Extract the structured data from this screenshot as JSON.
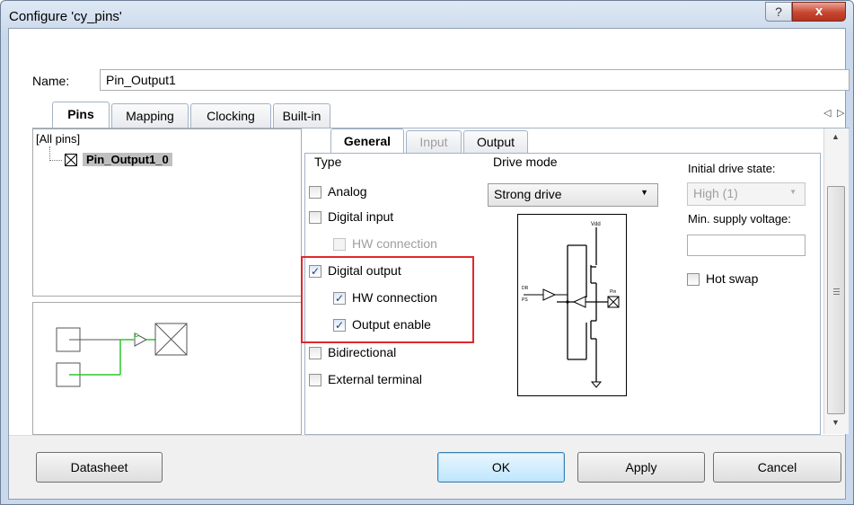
{
  "window": {
    "title": "Configure 'cy_pins'",
    "help_glyph": "?",
    "close_glyph": "x"
  },
  "name": {
    "label": "Name:",
    "value": "Pin_Output1"
  },
  "main_tabs": [
    {
      "label": "Pins",
      "active": true
    },
    {
      "label": "Mapping",
      "active": false
    },
    {
      "label": "Clocking",
      "active": false
    },
    {
      "label": "Built-in",
      "active": false
    }
  ],
  "tab_scroll": {
    "left": "◁",
    "right": "▷"
  },
  "pin_tree": {
    "root": "[All pins]",
    "items": [
      "Pin_Output1_0"
    ]
  },
  "sub_tabs": [
    {
      "label": "General",
      "active": true
    },
    {
      "label": "Input",
      "active": false
    },
    {
      "label": "Output",
      "active": false
    }
  ],
  "type_group": {
    "title": "Type",
    "analog": {
      "label": "Analog",
      "checked": false
    },
    "digital_input": {
      "label": "Digital input",
      "checked": false
    },
    "digital_input_hw": {
      "label": "HW connection",
      "checked": false,
      "disabled": true
    },
    "digital_output": {
      "label": "Digital output",
      "checked": true
    },
    "digital_output_hw": {
      "label": "HW connection",
      "checked": true
    },
    "output_enable": {
      "label": "Output enable",
      "checked": true
    },
    "bidirectional": {
      "label": "Bidirectional",
      "checked": false
    },
    "external_terminal": {
      "label": "External terminal",
      "checked": false
    }
  },
  "drive_mode": {
    "title": "Drive mode",
    "value": "Strong drive",
    "diagram_labels": {
      "vdd": "Vdd",
      "dr": "DR",
      "ps": "PS",
      "pin": "Pin"
    }
  },
  "initial_drive_state": {
    "label": "Initial drive state:",
    "value": "High (1)"
  },
  "min_supply_voltage": {
    "label": "Min. supply voltage:",
    "value": ""
  },
  "hot_swap": {
    "label": "Hot swap",
    "checked": false
  },
  "buttons": {
    "datasheet": "Datasheet",
    "ok": "OK",
    "apply": "Apply",
    "cancel": "Cancel"
  },
  "colors": {
    "highlight_box": "#e0282e",
    "wire_green": "#2ec72e",
    "title_bar": "#c9d8ea"
  }
}
